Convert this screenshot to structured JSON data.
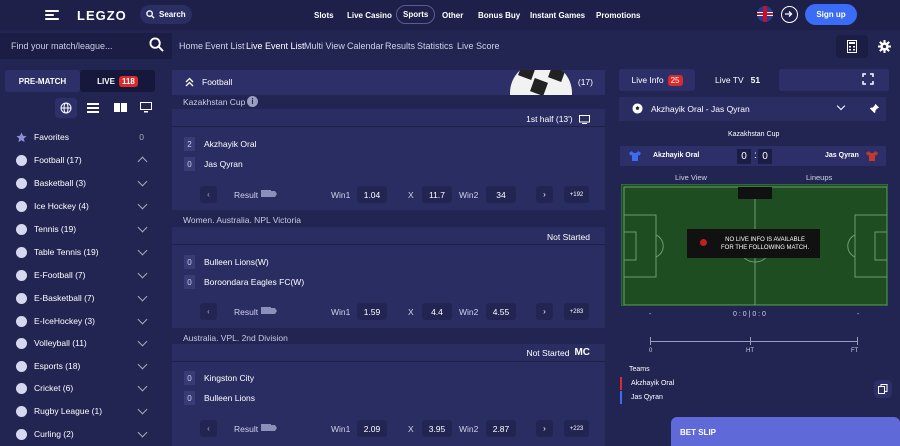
{
  "header": {
    "logo": "LEGZO",
    "search_label": "Search",
    "nav": [
      "Slots",
      "Live Casino",
      "Sports",
      "Other",
      "Bonus Buy",
      "Instant Games",
      "Promotions"
    ],
    "active_nav": "Sports",
    "signup_label": "Sign up"
  },
  "subheader": {
    "finder_placeholder": "Find your match/league...",
    "links": [
      "Home",
      "Event List",
      "Live Event List",
      "Multi View",
      "Calendar",
      "Results",
      "Statistics",
      "Live Score"
    ],
    "active_link": "Live Event List"
  },
  "sidebar": {
    "tab_prematch": "PRE-MATCH",
    "tab_live": "LIVE",
    "live_count": "118",
    "items": [
      {
        "label": "Favorites",
        "count": "0",
        "icon": "star-icon"
      },
      {
        "label": "Football (17)",
        "icon": "football-icon",
        "expanded": true
      },
      {
        "label": "Basketball (3)",
        "icon": "basketball-icon"
      },
      {
        "label": "Ice Hockey (4)",
        "icon": "ice-hockey-icon"
      },
      {
        "label": "Tennis (19)",
        "icon": "tennis-icon"
      },
      {
        "label": "Table Tennis (19)",
        "icon": "table-tennis-icon"
      },
      {
        "label": "E-Football (7)",
        "icon": "e-football-icon"
      },
      {
        "label": "E-Basketball (7)",
        "icon": "e-basketball-icon"
      },
      {
        "label": "E-IceHockey (3)",
        "icon": "e-icehockey-icon"
      },
      {
        "label": "Volleyball (11)",
        "icon": "volleyball-icon"
      },
      {
        "label": "Esports (18)",
        "icon": "esports-icon"
      },
      {
        "label": "Cricket (6)",
        "icon": "cricket-icon"
      },
      {
        "label": "Rugby League (1)",
        "icon": "rugby-icon"
      },
      {
        "label": "Curling (2)",
        "icon": "curling-icon"
      }
    ]
  },
  "center": {
    "sport_title": "Football",
    "sport_count": "(17)",
    "leagues": [
      {
        "name": "Kazakhstan Cup",
        "status": "1st half  (13')",
        "team1": "Akzhayik Oral",
        "score1": "2",
        "team2": "Jas Qyran",
        "score2": "0",
        "result_label": "Result",
        "win1_label": "Win1",
        "win1": "1.04",
        "x_label": "X",
        "x": "11.7",
        "win2_label": "Win2",
        "win2": "34",
        "more": "+192"
      },
      {
        "name": "Women. Australia. NPL Victoria",
        "status": "Not Started",
        "team1": "Bulleen Lions(W)",
        "score1": "0",
        "team2": "Boroondara Eagles FC(W)",
        "score2": "0",
        "result_label": "Result",
        "win1_label": "Win1",
        "win1": "1.59",
        "x_label": "X",
        "x": "4.4",
        "win2_label": "Win2",
        "win2": "4.55",
        "more": "+283"
      },
      {
        "name": "Australia. VPL. 2nd Division",
        "status": "Not Started",
        "status_tag": "MC",
        "team1": "Kingston City",
        "score1": "0",
        "team2": "Bulleen Lions",
        "score2": "0",
        "result_label": "Result",
        "win1_label": "Win1",
        "win1": "2.09",
        "x_label": "X",
        "x": "3.95",
        "win2_label": "Win2",
        "win2": "2.87",
        "more": "+223"
      }
    ]
  },
  "right": {
    "tab_liveinfo": "Live Info",
    "liveinfo_count": "25",
    "tab_livetv": "Live TV",
    "livetv_count": "51",
    "match_title": "Akzhayik Oral - Jas Qyran",
    "cup": "Kazakhstan Cup",
    "team1": "Akzhayik Oral",
    "team2": "Jas Qyran",
    "score1": "0",
    "score2": "0",
    "subtab1": "Live View",
    "subtab2": "Lineups",
    "noinfo_line1": "NO LIVE INFO IS AVAILABLE",
    "noinfo_line2": "FOR THE FOLLOWING MATCH.",
    "stat_left": "-",
    "stat_mid": "0 : 0 | 0 : 0",
    "stat_right": "-",
    "tl_start": "0",
    "tl_ht": "HT",
    "tl_ft": "FT",
    "teams_title": "Teams",
    "legend_team1": "Akzhayik Oral",
    "legend_team2": "Jas Qyran",
    "team1_color": "#d92b2b",
    "team2_color": "#3b6cf6",
    "betslip": "BET SLIP"
  }
}
